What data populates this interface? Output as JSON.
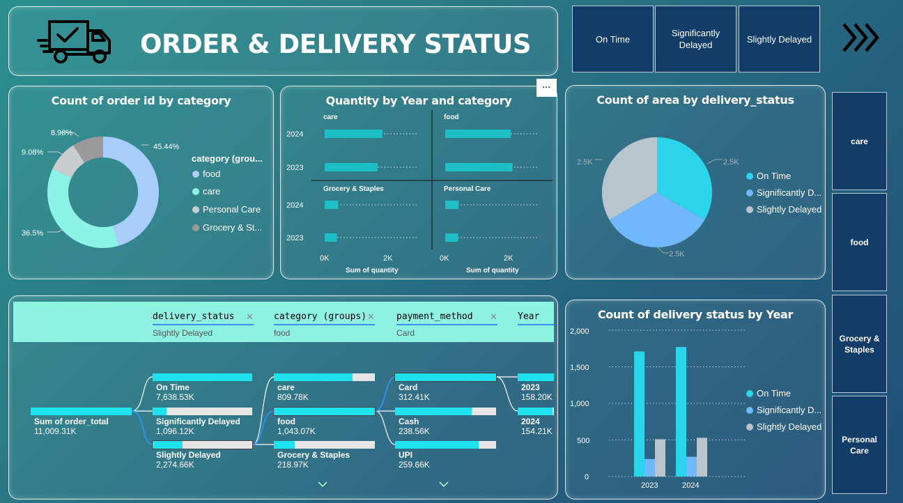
{
  "header": {
    "title": "ORDER & DELIVERY STATUS",
    "icon": "delivery-truck-icon"
  },
  "top_filters": [
    "On Time",
    "Significantly Delayed",
    "Slightly Delayed"
  ],
  "nav_icon": "chevrons-right-icon",
  "side_filters": [
    "care",
    "food",
    "Grocery & Staples",
    "Personal Care"
  ],
  "more_options_label": "···",
  "donut": {
    "title": "Count of order id by category",
    "legend_title": "category (grou...",
    "legend": [
      "food",
      "care",
      "Personal Care",
      "Grocery & St..."
    ],
    "labels": [
      "45.44%",
      "36.5%",
      "9.08%",
      "8.98%"
    ]
  },
  "qty": {
    "title": "Quantity by Year and category",
    "panels": [
      "care",
      "food",
      "Grocery & Staples",
      "Personal Care"
    ],
    "years": [
      "2024",
      "2023"
    ],
    "ticks": [
      "0K",
      "2K"
    ],
    "xlabel": "Sum of quantity"
  },
  "pie": {
    "title": "Count of area by delivery_status",
    "labels": [
      "2.5K",
      "2.5K",
      "2.5K"
    ],
    "legend": [
      "On Time",
      "Significantly D...",
      "Slightly Delayed"
    ]
  },
  "decomp": {
    "headers": [
      {
        "label": "delivery_status",
        "value": "Slightly Delayed"
      },
      {
        "label": "category (groups)",
        "value": "food"
      },
      {
        "label": "payment_method",
        "value": "Card"
      },
      {
        "label": "Year",
        "value": ""
      }
    ],
    "root": {
      "label": "Sum of order_total",
      "value": "11,009.31K"
    },
    "status": [
      {
        "label": "On Time",
        "value": "7,638.53K",
        "fill": 1.0
      },
      {
        "label": "Significantly Delayed",
        "value": "1,096.12K",
        "fill": 0.14
      },
      {
        "label": "Slightly Delayed",
        "value": "2,274.66K",
        "fill": 0.3
      }
    ],
    "category": [
      {
        "label": "care",
        "value": "809.78K",
        "fill": 0.78
      },
      {
        "label": "food",
        "value": "1,043.07K",
        "fill": 1.0
      },
      {
        "label": "Grocery & Staples",
        "value": "218.97K",
        "fill": 0.21
      }
    ],
    "payment": [
      {
        "label": "Card",
        "value": "312.41K",
        "fill": 1.0
      },
      {
        "label": "Cash",
        "value": "238.56K",
        "fill": 0.76
      },
      {
        "label": "UPI",
        "value": "259.66K",
        "fill": 0.83
      }
    ],
    "year": [
      {
        "label": "2023",
        "value": "158.20K",
        "fill": 1.0
      },
      {
        "label": "2024",
        "value": "154.21K",
        "fill": 0.97
      }
    ]
  },
  "bar": {
    "title": "Count of delivery status by Year",
    "yticks": [
      "2,000",
      "1,500",
      "1,000",
      "500",
      "0"
    ],
    "legend": [
      "On Time",
      "Significantly D...",
      "Slightly Delayed"
    ]
  },
  "colors": {
    "on_time": "#2ad4ea",
    "sig_delayed": "#6fb8fb",
    "slight_delayed": "#b9c5cc",
    "food": "#a8cdfb",
    "care": "#8df2e6",
    "personal_care": "#c9cdd0",
    "grocery": "#9a9a9a",
    "teal_bar": "#1cbfc6"
  },
  "chart_data": [
    {
      "type": "pie",
      "title": "Count of order id by category",
      "categories": [
        "food",
        "care",
        "Personal Care",
        "Grocery & Staples"
      ],
      "values": [
        45.44,
        36.5,
        9.08,
        8.98
      ]
    },
    {
      "type": "bar",
      "title": "Quantity by Year and category",
      "xlabel": "Sum of quantity",
      "categories": [
        "2024",
        "2023"
      ],
      "series": [
        {
          "name": "care",
          "values": [
            1800,
            1650
          ]
        },
        {
          "name": "food",
          "values": [
            2050,
            2100
          ]
        },
        {
          "name": "Grocery & Staples",
          "values": [
            420,
            380
          ]
        },
        {
          "name": "Personal Care",
          "values": [
            420,
            400
          ]
        }
      ],
      "xlim": [
        0,
        3000
      ]
    },
    {
      "type": "pie",
      "title": "Count of area by delivery_status",
      "categories": [
        "On Time",
        "Significantly Delayed",
        "Slightly Delayed"
      ],
      "values": [
        2500,
        2500,
        2500
      ]
    },
    {
      "type": "bar",
      "title": "Count of delivery status by Year",
      "categories": [
        "2023",
        "2024"
      ],
      "series": [
        {
          "name": "On Time",
          "values": [
            1710,
            1770
          ]
        },
        {
          "name": "Significantly Delayed",
          "values": [
            240,
            270
          ]
        },
        {
          "name": "Slightly Delayed",
          "values": [
            510,
            530
          ]
        }
      ],
      "ylim": [
        0,
        2000
      ]
    }
  ]
}
